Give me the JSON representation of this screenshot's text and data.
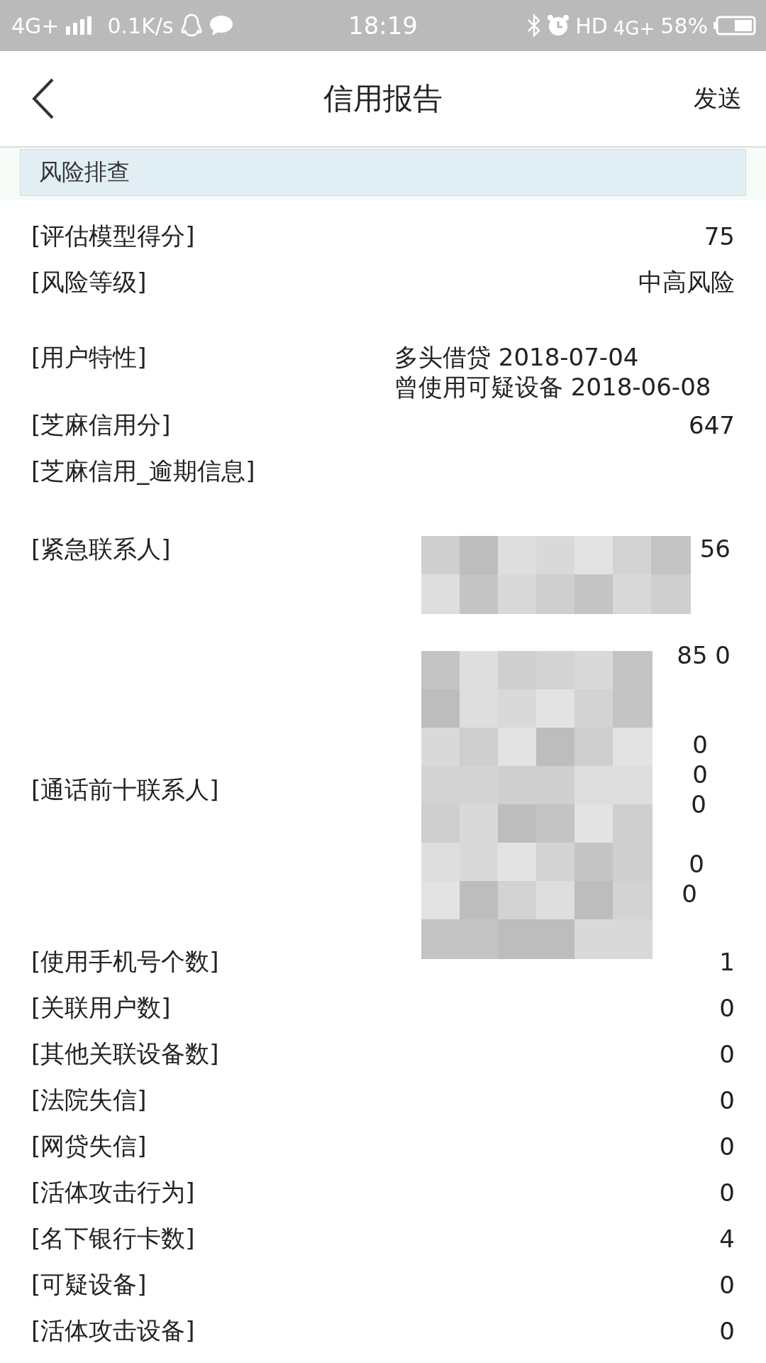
{
  "status_bar": {
    "network": "4G+",
    "speed": "0.1K/s",
    "time": "18:19",
    "hd": "HD",
    "network_right": "4G+",
    "battery": "58%"
  },
  "header": {
    "title": "信用报告",
    "action": "发送"
  },
  "section": {
    "title": "风险排查"
  },
  "rows": [
    {
      "kind": "single",
      "label": "[评估模型得分]",
      "value": "75"
    },
    {
      "kind": "single",
      "label": "[风险等级]",
      "value": "中高风险"
    },
    {
      "kind": "lines",
      "label": "[用户特性]",
      "lines": [
        {
          "kind": "text",
          "text": "多头借贷 2018-07-04"
        },
        {
          "kind": "text",
          "text": "曾使用可疑设备 2018-06-08"
        }
      ]
    },
    {
      "kind": "single",
      "label": "[芝麻信用分]",
      "value": "647"
    },
    {
      "kind": "single",
      "label": "[芝麻信用_逾期信息]"
    },
    {
      "kind": "fragments",
      "label": "[紧急联系人]",
      "lines": [
        {
          "kind": "text",
          "text": "56"
        },
        {
          "kind": "hidden"
        }
      ]
    },
    {
      "kind": "fragments_centered",
      "label": "[通话前十联系人]",
      "lines": [
        {
          "kind": "text",
          "text": "85 0"
        },
        {
          "kind": "hidden"
        },
        {
          "kind": "hidden"
        },
        {
          "kind": "text",
          "text": "0"
        },
        {
          "kind": "text",
          "text": "0"
        },
        {
          "kind": "text",
          "text": "0"
        },
        {
          "kind": "hidden"
        },
        {
          "kind": "text",
          "text": "0"
        },
        {
          "kind": "text",
          "text": "0"
        },
        {
          "kind": "hidden"
        }
      ]
    },
    {
      "kind": "single",
      "label": "[使用手机号个数]",
      "value": "1"
    },
    {
      "kind": "single",
      "label": "[关联用户数]",
      "value": "0"
    },
    {
      "kind": "single",
      "label": "[其他关联设备数]",
      "value": "0"
    },
    {
      "kind": "single",
      "label": "[法院失信]",
      "value": "0"
    },
    {
      "kind": "single",
      "label": "[网贷失信]",
      "value": "0"
    },
    {
      "kind": "single",
      "label": "[活体攻击行为]",
      "value": "0"
    },
    {
      "kind": "single",
      "label": "[名下银行卡数]",
      "value": "4"
    },
    {
      "kind": "single",
      "label": "[可疑设备]",
      "value": "0"
    },
    {
      "kind": "single",
      "label": "[活体攻击设备]",
      "value": "0"
    }
  ]
}
